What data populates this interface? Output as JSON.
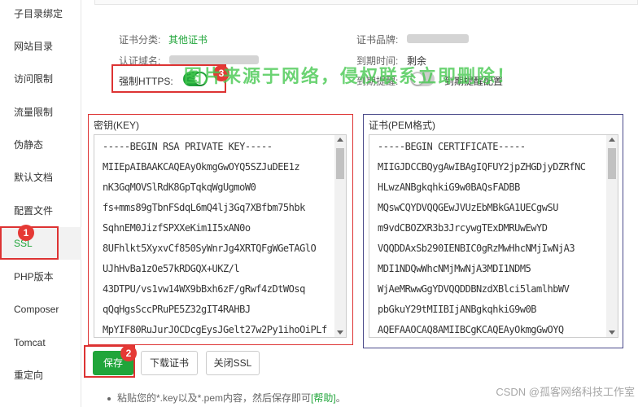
{
  "sidebar": {
    "items": [
      {
        "label": "子目录绑定"
      },
      {
        "label": "网站目录"
      },
      {
        "label": "访问限制"
      },
      {
        "label": "流量限制"
      },
      {
        "label": "伪静态"
      },
      {
        "label": "默认文档"
      },
      {
        "label": "配置文件"
      },
      {
        "label": "SSL"
      },
      {
        "label": "PHP版本"
      },
      {
        "label": "Composer"
      },
      {
        "label": "Tomcat"
      },
      {
        "label": "重定向"
      }
    ],
    "active": "SSL"
  },
  "cert_info": {
    "category_label": "证书分类:",
    "category_value": "其他证书",
    "brand_label": "证书品牌:",
    "domain_label": "认证域名:",
    "expire_label": "到期时间:",
    "expire_value": "剩余",
    "https_label": "强制HTTPS:",
    "https_enabled": true,
    "remind_label": "到期提醒:",
    "remind_enabled": false,
    "remind_config_label": "到期提醒配置"
  },
  "key_panel": {
    "title": "密钥(KEY)",
    "lines": [
      "-----BEGIN RSA PRIVATE KEY-----",
      "MIIEpAIBAAKCAQEAyOkmgGwOYQ5SZJuDEE1z",
      "nK3GqMOVSlRdK8GpTqkqWgUgmoW0",
      "fs+mms89gTbnFSdqL6mQ4lj3Gq7XBfbm75hbk",
      "SqhnEM0JizfSPXXeKim1I5xAN0o",
      "8UFhlkt5XyxvCf850SyWnrJg4XRTQFgWGeTAGlO",
      "UJhHvBa1zOe57kRDGQX+UKZ/l",
      "43DTPU/vs1vw14WX9bBxh6zF/gRwf4zDtWOsq",
      "qQqHgsSccPRuPE5Z32gIT4RAHBJ",
      "MpYIF80RuJurJOCDcgEysJGelt27w2Py1ihoOiPLf"
    ]
  },
  "cert_panel": {
    "title": "证书(PEM格式)",
    "lines": [
      "-----BEGIN CERTIFICATE-----",
      "MIIGJDCCBQygAwIBAgIQFUY2jpZHGDjyDZRfNC",
      "HLwzANBgkqhkiG9w0BAQsFADBB",
      "MQswCQYDVQQGEwJVUzEbMBkGA1UECgwSU",
      "m9vdCBOZXR3b3JrcywgTExDMRUwEwYD",
      "VQQDDAxSb290IENBIC0gRzMwHhcNMjIwNjA3",
      "MDI1NDQwWhcNMjMwNjA3MDI1NDM5",
      "WjAeMRwwGgYDVQQDDBNzdXBlci5lamlhbWV",
      "pbGkuY29tMIIBIjANBgkqhkiG9w0B",
      "AQEFAAOCAQ8AMIIBCgKCAQEAyOkmgGwOYQ"
    ]
  },
  "actions": {
    "save": "保存",
    "download": "下载证书",
    "close_ssl": "关闭SSL"
  },
  "help": {
    "text": "粘贴您的*.key以及*.pem内容，然后保存即可",
    "link": "[帮助]",
    "suffix": "。"
  },
  "annotations": {
    "badge1": "1",
    "badge2": "2",
    "badge3": "3",
    "accent": "#e53935"
  },
  "watermark": "图片来源于网络，侵权联系立即删除！",
  "csdn_credit": "CSDN @孤客网络科技工作室",
  "colors": {
    "brand": "#20a53a",
    "highlight": "#d33"
  }
}
